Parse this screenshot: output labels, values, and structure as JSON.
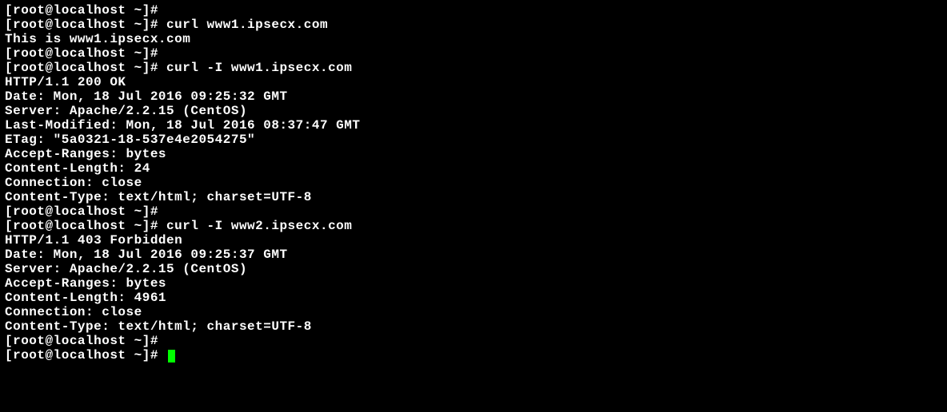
{
  "session": {
    "user": "root",
    "host": "localhost",
    "cwd": "~",
    "prompt_prefix": "[root@localhost ~]#"
  },
  "lines": [
    {
      "text": "[root@localhost ~]#"
    },
    {
      "text": "[root@localhost ~]# curl www1.ipsecx.com"
    },
    {
      "text": "This is www1.ipsecx.com"
    },
    {
      "text": "[root@localhost ~]#"
    },
    {
      "text": "[root@localhost ~]# curl -I www1.ipsecx.com"
    },
    {
      "text": "HTTP/1.1 200 OK"
    },
    {
      "text": "Date: Mon, 18 Jul 2016 09:25:32 GMT"
    },
    {
      "text": "Server: Apache/2.2.15 (CentOS)"
    },
    {
      "text": "Last-Modified: Mon, 18 Jul 2016 08:37:47 GMT"
    },
    {
      "text": "ETag: \"5a0321-18-537e4e2054275\""
    },
    {
      "text": "Accept-Ranges: bytes"
    },
    {
      "text": "Content-Length: 24"
    },
    {
      "text": "Connection: close"
    },
    {
      "text": "Content-Type: text/html; charset=UTF-8"
    },
    {
      "text": ""
    },
    {
      "text": "[root@localhost ~]#"
    },
    {
      "text": "[root@localhost ~]# curl -I www2.ipsecx.com"
    },
    {
      "text": "HTTP/1.1 403 Forbidden"
    },
    {
      "text": "Date: Mon, 18 Jul 2016 09:25:37 GMT"
    },
    {
      "text": "Server: Apache/2.2.15 (CentOS)"
    },
    {
      "text": "Accept-Ranges: bytes"
    },
    {
      "text": "Content-Length: 4961"
    },
    {
      "text": "Connection: close"
    },
    {
      "text": "Content-Type: text/html; charset=UTF-8"
    },
    {
      "text": ""
    },
    {
      "text": "[root@localhost ~]#"
    },
    {
      "text": "[root@localhost ~]# ",
      "cursor": true
    }
  ]
}
